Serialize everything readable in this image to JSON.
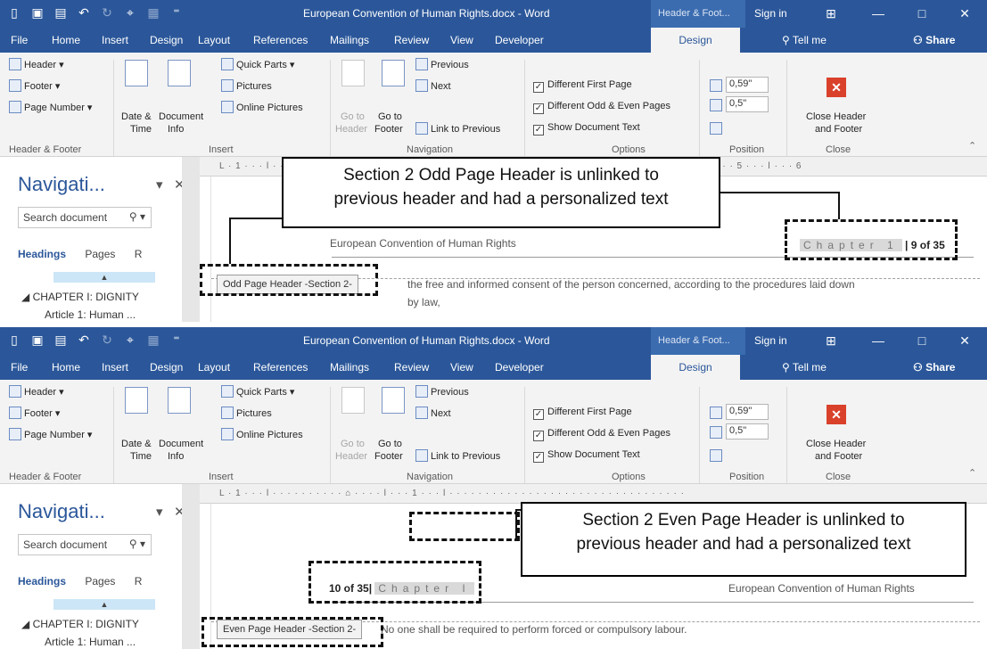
{
  "window": {
    "title": "European Convention of Human Rights.docx - Word",
    "context_tab": "Header & Foot...",
    "sign_in": "Sign in",
    "colors": {
      "title_bar": "#2b579a",
      "ribbon": "#f3f3f3",
      "close_header": "#d9412b"
    }
  },
  "tabs": {
    "items": [
      "File",
      "Home",
      "Insert",
      "Design",
      "Layout",
      "References",
      "Mailings",
      "Review",
      "View",
      "Developer"
    ],
    "active": "Design",
    "tell_me": "Tell me",
    "share": "Share"
  },
  "ribbon": {
    "header_footer": {
      "header": "Header",
      "footer": "Footer",
      "page_number": "Page Number",
      "label": "Header & Footer"
    },
    "insert": {
      "date_time_1": "Date &",
      "date_time_2": "Time",
      "doc_info_1": "Document",
      "doc_info_2": "Info",
      "quick_parts": "Quick Parts",
      "pictures": "Pictures",
      "online_pictures": "Online Pictures",
      "label": "Insert"
    },
    "navigation": {
      "go_to_header_1": "Go to",
      "go_to_header_2": "Header",
      "go_to_footer_1": "Go to",
      "go_to_footer_2": "Footer",
      "previous": "Previous",
      "next": "Next",
      "link_to_previous": "Link to Previous",
      "label": "Navigation"
    },
    "options": {
      "different_first_page": "Different First Page",
      "different_odd_even": "Different Odd & Even Pages",
      "show_document_text": "Show Document Text",
      "label": "Options"
    },
    "position": {
      "header_from_top": "0,59\"",
      "footer_from_bottom": "0,5\"",
      "label": "Position"
    },
    "close": {
      "close_header_1": "Close Header",
      "close_header_2": "and Footer",
      "label": "Close"
    }
  },
  "nav_pane": {
    "title": "Navigati...",
    "search_placeholder": "Search document",
    "tab_headings": "Headings",
    "tab_pages": "Pages",
    "tab_results": "R",
    "chapter": "CHAPTER I: DIGNITY",
    "article": "Article 1: Human ..."
  },
  "top": {
    "callout_line1": "Section 2 Odd Page Header is unlinked to",
    "callout_line2": "previous header and had a personalized text",
    "header_left_text": "European Convention of Human Rights",
    "chapter_text": "Chapter 1",
    "page_text": "| 9 of 35",
    "header_tag": "Odd Page Header -Section 2-",
    "body_line1": "the free and informed consent of the person concerned, according to the procedures laid down",
    "body_line2": "by law,"
  },
  "bottom": {
    "callout_line1": "Section 2 Even Page Header is unlinked to",
    "callout_line2": "previous header and had a personalized text",
    "header_right_text": "European Convention of Human Rights",
    "page_text": "10 of 35|",
    "chapter_text": "Chapter I",
    "header_tag": "Even Page Header -Section 2-",
    "body_line1": "No one shall be required to perform forced or compulsory labour."
  }
}
